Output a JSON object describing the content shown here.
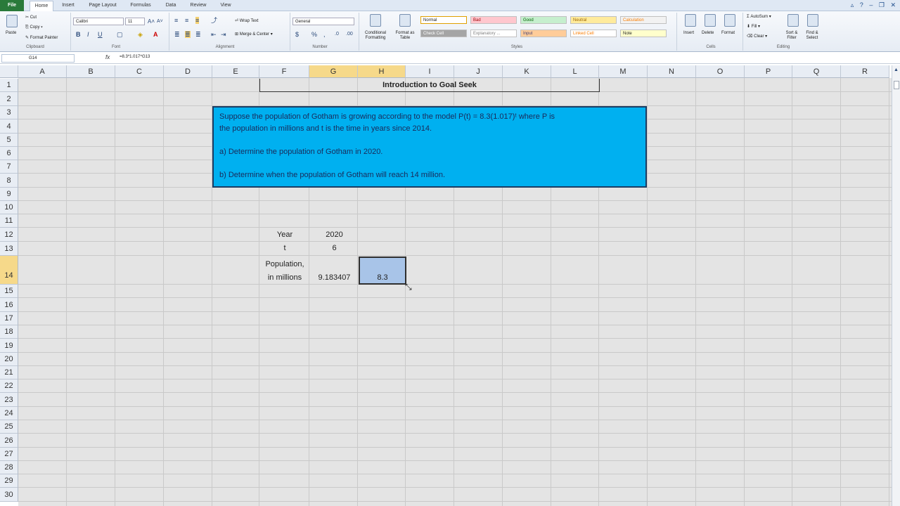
{
  "tabs": [
    "File",
    "Home",
    "Insert",
    "Page Layout",
    "Formulas",
    "Data",
    "Review",
    "View"
  ],
  "ribbon": {
    "clipboard": {
      "paste": "Paste",
      "cut": "Cut",
      "copy": "Copy",
      "format_painter": "Format Painter",
      "label": "Clipboard"
    },
    "font": {
      "name": "Calibri",
      "size": "11",
      "label": "Font"
    },
    "alignment": {
      "wrap": "Wrap Text",
      "merge": "Merge & Center",
      "label": "Alignment"
    },
    "number": {
      "format": "General",
      "label": "Number"
    },
    "styles": {
      "conditional": "Conditional Formatting",
      "format_table": "Format as Table",
      "items": [
        {
          "name": "Normal",
          "bg": "#ffffff",
          "fg": "#222222"
        },
        {
          "name": "Bad",
          "bg": "#ffc7ce",
          "fg": "#9c0006"
        },
        {
          "name": "Good",
          "bg": "#c6efce",
          "fg": "#006100"
        },
        {
          "name": "Neutral",
          "bg": "#ffeb9c",
          "fg": "#9c6500"
        },
        {
          "name": "Calculation",
          "bg": "#f2f2f2",
          "fg": "#fa7d00"
        },
        {
          "name": "Check Cell",
          "bg": "#a5a5a5",
          "fg": "#ffffff"
        },
        {
          "name": "Explanatory ...",
          "bg": "#ffffff",
          "fg": "#7f7f7f"
        },
        {
          "name": "Input",
          "bg": "#ffcc99",
          "fg": "#3f3f76"
        },
        {
          "name": "Linked Cell",
          "bg": "#ffffff",
          "fg": "#fa7d00"
        },
        {
          "name": "Note",
          "bg": "#ffffcc",
          "fg": "#222222"
        }
      ],
      "label": "Styles"
    },
    "cells": {
      "insert": "Insert",
      "delete": "Delete",
      "format": "Format",
      "label": "Cells"
    },
    "editing": {
      "autosum": "AutoSum",
      "fill": "Fill",
      "clear": "Clear",
      "sort": "Sort & Filter",
      "find": "Find & Select",
      "label": "Editing"
    }
  },
  "formula_bar": {
    "name_box": "G14",
    "fx": "fx",
    "formula": "=8.3*1.017^G13"
  },
  "columns": [
    "A",
    "B",
    "C",
    "D",
    "E",
    "F",
    "G",
    "H",
    "I",
    "J",
    "K",
    "L",
    "M",
    "N",
    "O",
    "P",
    "Q",
    "R"
  ],
  "rows": [
    "1",
    "2",
    "3",
    "4",
    "5",
    "6",
    "7",
    "8",
    "9",
    "10",
    "11",
    "12",
    "13",
    "14",
    "15",
    "16",
    "17",
    "18",
    "19",
    "20",
    "21",
    "22",
    "23",
    "24",
    "25",
    "26",
    "27",
    "28",
    "29",
    "30"
  ],
  "sheet": {
    "title": "Introduction to Goal Seek",
    "problem": {
      "line1": "Suppose the population of Gotham is growing according to the model  P(t) = 8.3(1.017)ᵗ where P is",
      "line2": "the population in millions and t is the time in years since 2014.",
      "part_a": "a) Determine the population of Gotham in 2020.",
      "part_b": "b) Determine when the population of Gotham will reach 14 million."
    },
    "year_label": "Year",
    "year_value": "2020",
    "t_label": "t",
    "t_value": "6",
    "pop_label1": "Population,",
    "pop_label2": "in millions",
    "pop_value": "9.183407",
    "h14_value": "8.3"
  }
}
